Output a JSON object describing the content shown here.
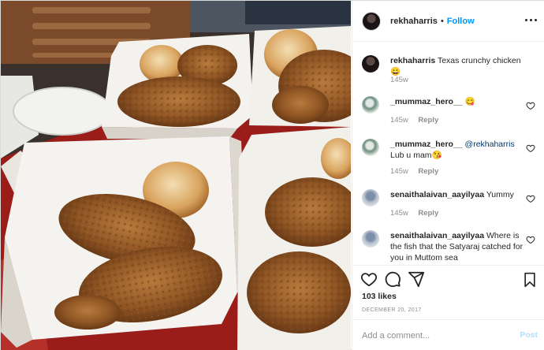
{
  "post": {
    "username": "rekhaharris",
    "separator": "•",
    "follow_label": "Follow",
    "more_icon": "more-options-icon",
    "photo_alt": "Texas crunchy chicken"
  },
  "comments": [
    {
      "user": "rekhaharris",
      "text": "Texas crunchy chicken 😀",
      "time": "145w",
      "reply": ""
    },
    {
      "user": "_mummaz_hero__",
      "text": "😋",
      "time": "145w",
      "reply": "Reply"
    },
    {
      "user": "_mummaz_hero__",
      "mention": "@rekhaharris",
      "text": "Lub u mam😘",
      "time": "145w",
      "reply": "Reply"
    },
    {
      "user": "senaithalaivan_aayilyaa",
      "text": "Yummy",
      "time": "145w",
      "reply": "Reply"
    },
    {
      "user": "senaithalaivan_aayilyaa",
      "text": "Where is the fish that the Satyaraj catched for you in Muttom sea",
      "time": "",
      "reply": ""
    }
  ],
  "actions": {
    "likes": "103 likes",
    "date": "DECEMBER 20, 2017",
    "icons": [
      "heart-icon",
      "comment-icon",
      "share-icon",
      "bookmark-icon"
    ]
  },
  "add_comment": {
    "placeholder": "Add a comment...",
    "post_label": "Post"
  },
  "colors": {
    "link_blue": "#0095f6",
    "post_disabled": "#b2dffc",
    "muted": "#8e8e8e"
  }
}
